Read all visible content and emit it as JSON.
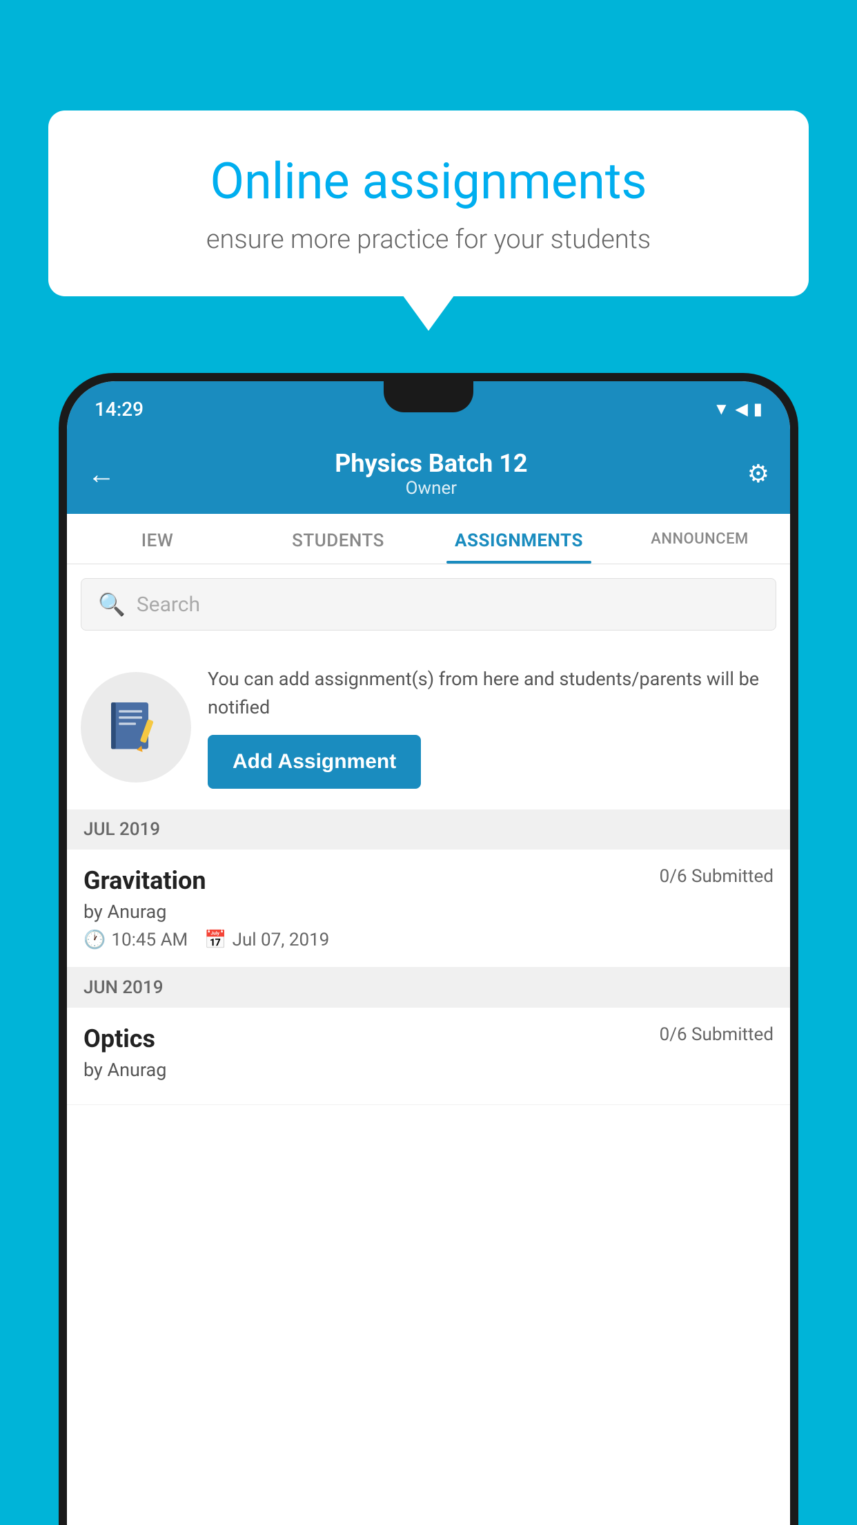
{
  "background_color": "#00B4D8",
  "speech_bubble": {
    "title": "Online assignments",
    "subtitle": "ensure more practice for your students"
  },
  "phone": {
    "status_bar": {
      "time": "14:29",
      "icons": [
        "wifi",
        "signal",
        "battery"
      ]
    },
    "header": {
      "title": "Physics Batch 12",
      "subtitle": "Owner",
      "back_label": "←",
      "gear_label": "⚙"
    },
    "tabs": [
      {
        "label": "IEW",
        "active": false
      },
      {
        "label": "STUDENTS",
        "active": false
      },
      {
        "label": "ASSIGNMENTS",
        "active": true
      },
      {
        "label": "ANNOUNCEM...",
        "active": false
      }
    ],
    "search": {
      "placeholder": "Search"
    },
    "add_assignment_section": {
      "description": "You can add assignment(s) from here and students/parents will be notified",
      "button_label": "Add Assignment"
    },
    "month_groups": [
      {
        "month": "JUL 2019",
        "assignments": [
          {
            "name": "Gravitation",
            "submitted": "0/6 Submitted",
            "by": "by Anurag",
            "time": "10:45 AM",
            "date": "Jul 07, 2019"
          }
        ]
      },
      {
        "month": "JUN 2019",
        "assignments": [
          {
            "name": "Optics",
            "submitted": "0/6 Submitted",
            "by": "by Anurag",
            "time": "",
            "date": ""
          }
        ]
      }
    ]
  }
}
